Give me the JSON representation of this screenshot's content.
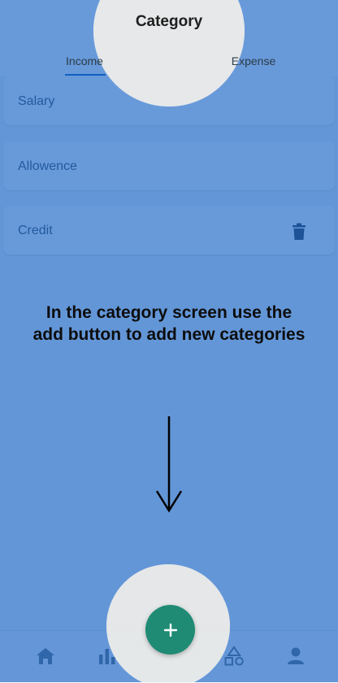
{
  "header": {
    "title": "Category"
  },
  "tabs": [
    {
      "label": "Income",
      "active": true
    },
    {
      "label": "Expense",
      "active": false
    }
  ],
  "categories": [
    {
      "label": "Salary"
    },
    {
      "label": "Allowence"
    },
    {
      "label": "Credit",
      "show_delete": true
    }
  ],
  "tutorial": {
    "text": "In the category screen use the add button to add new categories"
  },
  "fab": {
    "icon": "plus-icon",
    "color": "#1f8b74"
  },
  "bottom_nav": [
    "home-icon",
    "bar-chart-icon",
    "category-shapes-icon",
    "profile-icon"
  ],
  "colors": {
    "overlay": "#0b5cc4",
    "highlight": "#e2e5e6",
    "accent": "#1565c0"
  }
}
